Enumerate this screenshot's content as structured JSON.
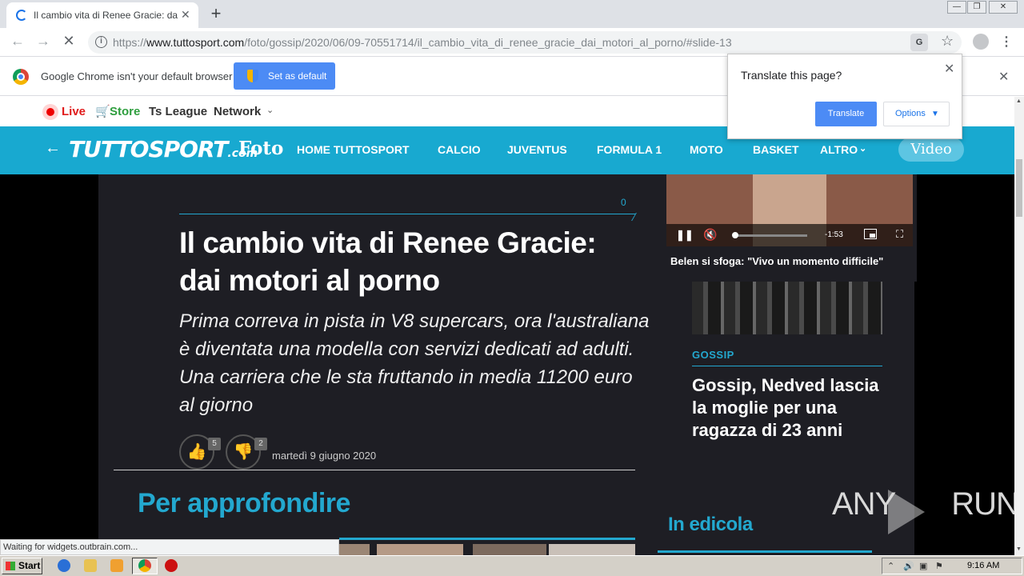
{
  "browser": {
    "tab_title": "Il cambio vita di Renee Gracie: dai m",
    "url_prefix": "https://",
    "url_domain": "www.tuttosport.com",
    "url_path": "/foto/gossip/2020/06/09-70551714/il_cambio_vita_di_renee_gracie_dai_motori_al_porno/#slide-13",
    "translate_icon": "G",
    "infobar_text": "Google Chrome isn't your default browser",
    "set_default_label": "Set as default"
  },
  "translate_popup": {
    "title": "Translate this page?",
    "translate_label": "Translate",
    "options_label": "Options"
  },
  "site_top": {
    "live": "Live",
    "store": "Store",
    "ts_league": "Ts League",
    "network": "Network"
  },
  "site_nav": {
    "logo": "TUTTOSPORT",
    "logo_suffix": ".com",
    "foto": "Foto",
    "links": [
      "HOME TUTTOSPORT",
      "CALCIO",
      "JUVENTUS",
      "FORMULA 1",
      "MOTO",
      "BASKET",
      "ALTRO"
    ],
    "video": "Video"
  },
  "article": {
    "comment_count": "0",
    "headline": "Il cambio vita di Renee Gracie: dai motori al porno",
    "subhead": "Prima correva in pista in V8 supercars, ora l'australiana è diventata una modella con servizi dedicati ad adulti. Una carriera che le sta fruttando in media 11200 euro al giorno",
    "likes": "5",
    "dislikes": "2",
    "date": "martedì 9 giugno 2020",
    "related_heading": "Per approfondire"
  },
  "sidebar": {
    "tag": "GOSSIP",
    "title": "Gossip, Nedved lascia la moglie per una ragazza di 23 anni",
    "edicola": "In edicola"
  },
  "video": {
    "time": "-1:53",
    "caption": "Belen si sfoga: \"Vivo un momento difficile\"",
    "progress": 0.02
  },
  "status_text": "Waiting for widgets.outbrain.com...",
  "watermark": {
    "left": "ANY",
    "right": "RUN"
  },
  "taskbar": {
    "start": "Start",
    "clock": "9:16 AM"
  }
}
